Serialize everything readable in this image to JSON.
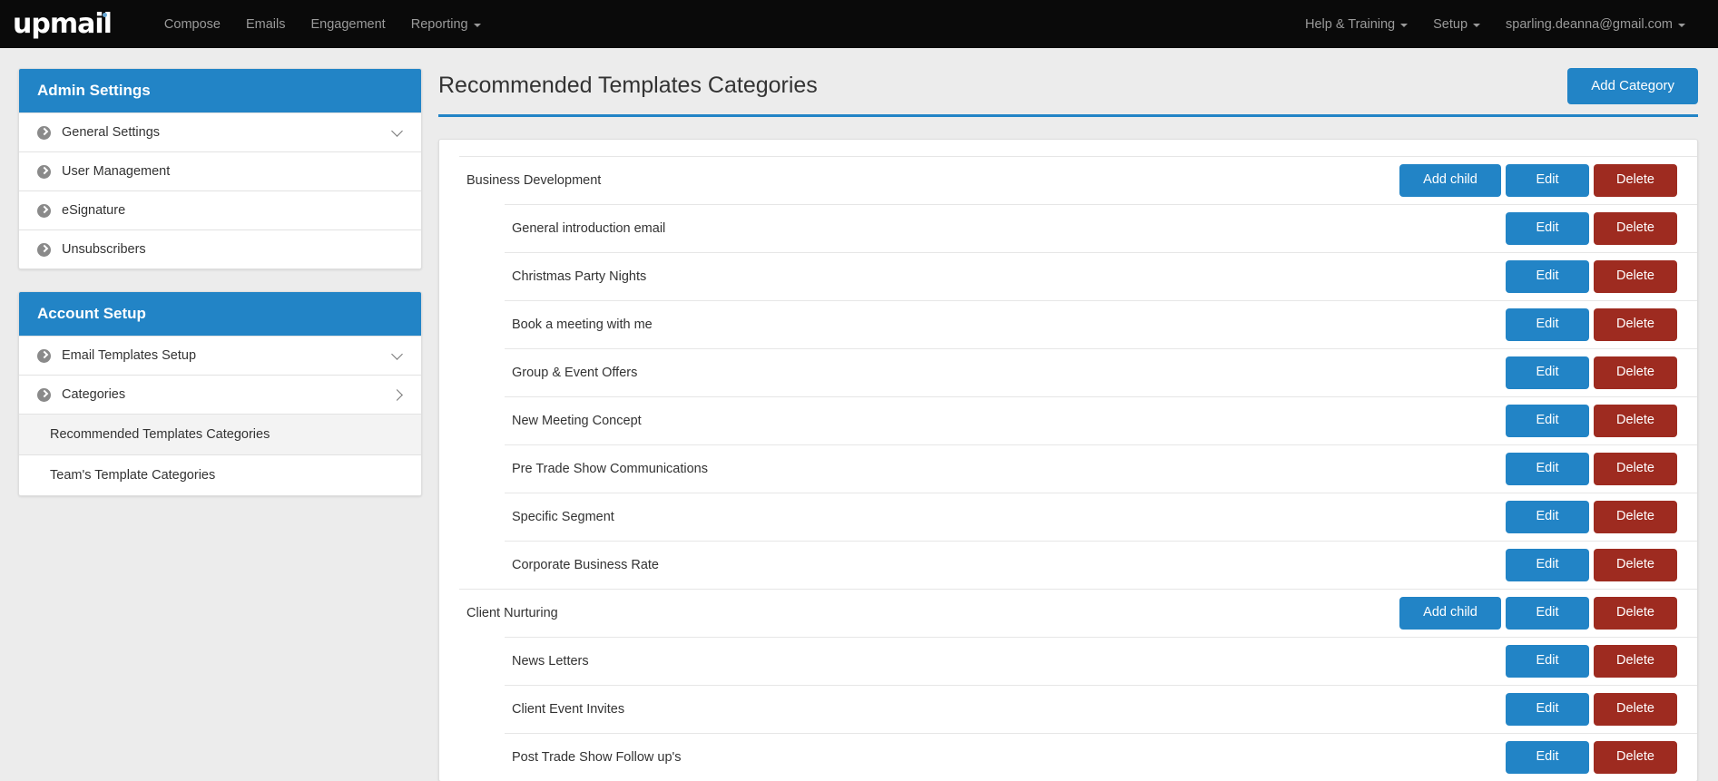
{
  "navbar": {
    "logo_text": "upmail",
    "left_items": [
      {
        "label": "Compose",
        "caret": false
      },
      {
        "label": "Emails",
        "caret": false
      },
      {
        "label": "Engagement",
        "caret": false
      },
      {
        "label": "Reporting",
        "caret": true
      }
    ],
    "right_items": [
      {
        "label": "Help & Training",
        "caret": true
      },
      {
        "label": "Setup",
        "caret": true
      },
      {
        "label": "sparling.deanna@gmail.com",
        "caret": true
      }
    ]
  },
  "sidebar": {
    "panels": [
      {
        "title": "Admin Settings",
        "items": [
          {
            "label": "General Settings",
            "chevron": "down"
          },
          {
            "label": "User Management",
            "chevron": "none"
          },
          {
            "label": "eSignature",
            "chevron": "none"
          },
          {
            "label": "Unsubscribers",
            "chevron": "none"
          }
        ],
        "sub_items": []
      },
      {
        "title": "Account Setup",
        "items": [
          {
            "label": "Email Templates Setup",
            "chevron": "down"
          },
          {
            "label": "Categories",
            "chevron": "right"
          }
        ],
        "sub_items": [
          {
            "label": "Recommended Templates Categories",
            "active": true
          },
          {
            "label": "Team's Template Categories",
            "active": false
          }
        ]
      }
    ]
  },
  "main": {
    "page_title": "Recommended Templates Categories",
    "add_category_label": "Add Category",
    "buttons": {
      "add_child": "Add child",
      "edit": "Edit",
      "delete": "Delete"
    },
    "categories": [
      {
        "name": "Business Development",
        "children": [
          {
            "name": "General introduction email"
          },
          {
            "name": "Christmas Party Nights"
          },
          {
            "name": "Book a meeting with me"
          },
          {
            "name": "Group & Event Offers"
          },
          {
            "name": "New Meeting Concept"
          },
          {
            "name": "Pre Trade Show Communications"
          },
          {
            "name": "Specific Segment"
          },
          {
            "name": "Corporate Business Rate"
          }
        ]
      },
      {
        "name": "Client Nurturing",
        "children": [
          {
            "name": "News Letters"
          },
          {
            "name": "Client Event Invites"
          },
          {
            "name": "Post Trade Show Follow up's"
          }
        ]
      }
    ]
  },
  "colors": {
    "brand_blue": "#2284c6",
    "danger_red": "#9e2b20",
    "navbar_black": "#0a0a0a",
    "page_background": "#ececec",
    "logo_dot_blue": "#6aa9d6"
  }
}
